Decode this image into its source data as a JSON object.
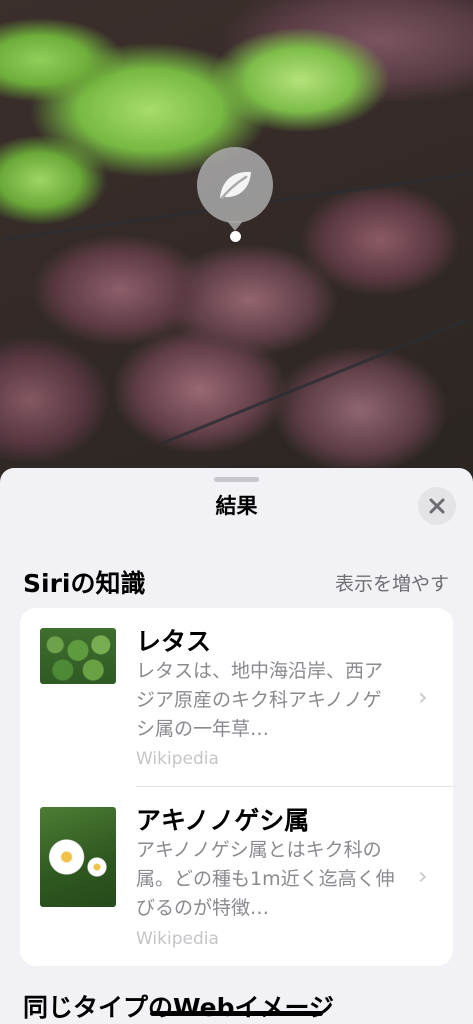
{
  "photo": {
    "subject_icon": "leaf-icon"
  },
  "sheet": {
    "title": "結果",
    "close_icon": "close-icon"
  },
  "siri_knowledge": {
    "header": "Siriの知識",
    "show_more": "表示を増やす",
    "results": [
      {
        "title": "レタス",
        "description": "レタスは、地中海沿岸、西アジア原産のキク科アキノノゲシ属の一年草…",
        "source": "Wikipedia",
        "thumbnail": "lettuce-thumbnail"
      },
      {
        "title": "アキノノゲシ属",
        "description": "アキノノゲシ属とはキク科の属。どの種も1m近く迄高く伸びるのが特徴…",
        "source": "Wikipedia",
        "thumbnail": "daisy-thumbnail"
      }
    ]
  },
  "similar_images": {
    "header": "同じタイプのWebイメージ"
  },
  "colors": {
    "sheet_bg": "#f2f1f6",
    "card_bg": "#ffffff",
    "secondary_text": "#8a8a8f"
  }
}
